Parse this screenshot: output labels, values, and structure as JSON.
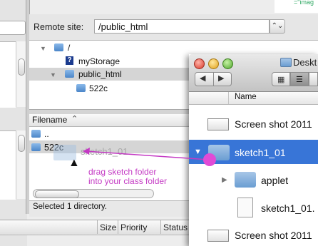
{
  "remote": {
    "label": "Remote site:",
    "path": "/public_html"
  },
  "remote_tree": {
    "root": "/",
    "items": [
      {
        "label": "myStorage",
        "kind": "unknown"
      },
      {
        "label": "public_html",
        "kind": "folder"
      },
      {
        "label": "522c",
        "kind": "folder"
      }
    ]
  },
  "file_list": {
    "column_filename": "Filename",
    "rows": [
      ".."
    ],
    "selected_row": "522c",
    "ghost_label": "sketch1_01",
    "status": "Selected 1 directory."
  },
  "queue": {
    "columns": [
      "Size",
      "Priority",
      "Status"
    ]
  },
  "top_snippet": "=\"imag",
  "top_snippet2": ".   </",
  "finder": {
    "title": "Deskt",
    "column_name": "Name",
    "rows": [
      {
        "label": "Screen shot 2011",
        "kind": "screenshot"
      },
      {
        "label": "sketch1_01",
        "kind": "folder",
        "selected": true
      },
      {
        "label": "applet",
        "kind": "folder"
      },
      {
        "label": "sketch1_01.",
        "kind": "doc"
      },
      {
        "label": "Screen shot 2011",
        "kind": "screenshot"
      }
    ]
  },
  "annotation": {
    "line1": "drag sketch folder",
    "line2": "into your class folder",
    "color": "#c43ac4"
  },
  "colors": {
    "selection_blue": "#3875d7",
    "folder_blue": "#4b86c8"
  }
}
